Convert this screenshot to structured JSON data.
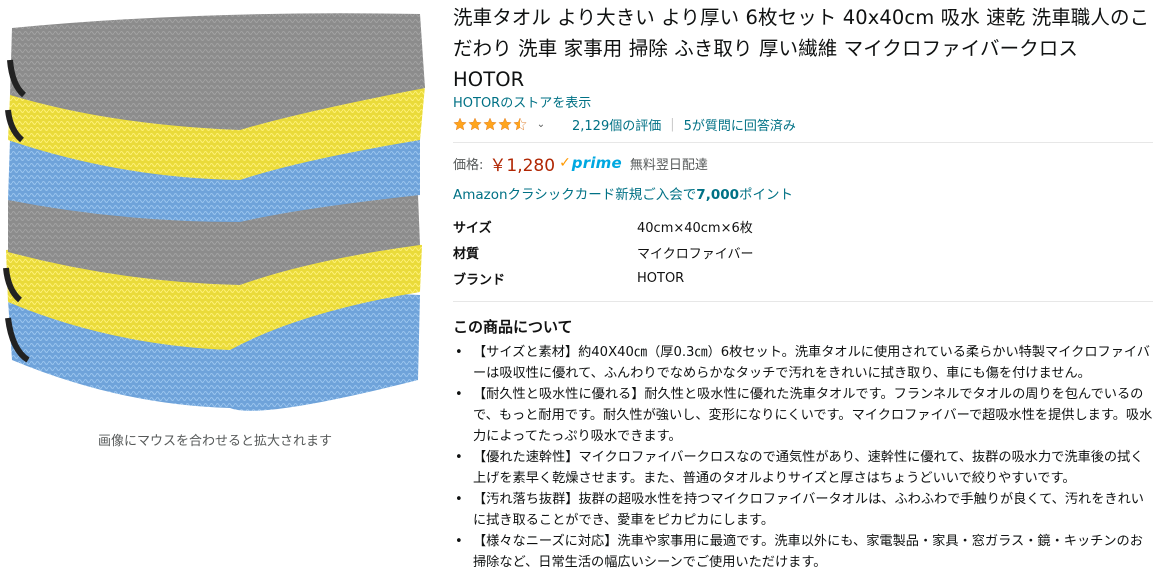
{
  "gallery": {
    "hover_hint": "画像にマウスを合わせると拡大されます",
    "towel_colors": [
      "#8f8f8f",
      "#f2e24a",
      "#7aaee3",
      "#8f8f8f",
      "#f2e24a",
      "#7aaee3"
    ]
  },
  "product": {
    "title": "洗車タオル より大きい より厚い 6枚セット 40x40cm 吸水 速乾 洗車職人のこだわり 洗車 家事用 掃除 ふき取り 厚い繊維 マイクロファイバークロス HOTOR",
    "store_link": "HOTORのストアを表示",
    "rating_stars": 4.5,
    "rating_count": "2,129個の評価",
    "answered": "5が質問に回答済み",
    "price_label": "価格:",
    "price": "￥1,280",
    "prime_text": "prime",
    "delivery": "無料翌日配達",
    "card_promo_prefix": "Amazonクラシックカード新規ご入会で",
    "card_promo_points": "7,000",
    "card_promo_suffix": "ポイント"
  },
  "specs": [
    {
      "key": "サイズ",
      "value": "40cm×40cm×6枚"
    },
    {
      "key": "材質",
      "value": "マイクロファイバー"
    },
    {
      "key": "ブランド",
      "value": "HOTOR"
    }
  ],
  "about": {
    "title": "この商品について",
    "bullets": [
      "【サイズと素材】約40X40㎝（厚0.3㎝）6枚セット。洗車タオルに使用されている柔らかい特製マイクロファイバーは吸収性に優れて、ふんわりでなめらかなタッチで汚れをきれいに拭き取り、車にも傷を付けません。",
      "【耐久性と吸水性に優れる】耐久性と吸水性に優れた洗車タオルです。フランネルでタオルの周りを包んでいるので、もっと耐用です。耐久性が強いし、変形になりにくいです。マイクロファイバーで超吸水性を提供します。吸水力によってたっぷり吸水できます。",
      "【優れた速幹性】マイクロファイバークロスなので通気性があり、速幹性に優れて、抜群の吸水力で洗車後の拭く上げを素早く乾燥させます。また、普通のタオルよりサイズと厚さはちょうどいいで絞りやすいです。",
      "【汚れ落ち抜群】抜群の超吸水性を持つマイクロファイバータオルは、ふわふわで手触りが良くて、汚れをきれいに拭き取ることができ、愛車をピカピカにします。",
      "【様々なニーズに対応】洗車や家事用に最適です。洗車以外にも、家電製品・家具・窓ガラス・鏡・キッチンのお掃除など、日常生活の幅広いシーンでご使用いただけます。"
    ]
  },
  "colors": {
    "link": "#007185",
    "price": "#B12704",
    "star": "#FFA41C",
    "prime_check": "#FF9900",
    "prime_word": "#00A8E1"
  }
}
